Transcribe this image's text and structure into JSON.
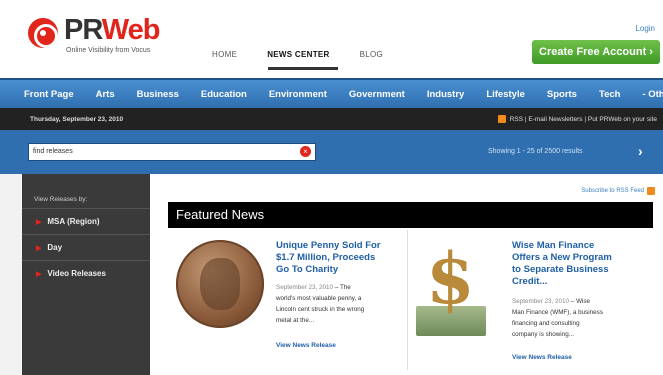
{
  "header": {
    "logo_word_pr": "PR",
    "logo_word_web": "Web",
    "logo_tagline": "Online Visibility from Vocus",
    "login": "Login",
    "cta": "Create Free Account ›"
  },
  "topnav": [
    "HOME",
    "NEWS CENTER",
    "BLOG"
  ],
  "categories": [
    "Front Page",
    "Arts",
    "Business",
    "Education",
    "Environment",
    "Government",
    "Industry",
    "Lifestyle",
    "Sports",
    "Tech",
    "- Oth"
  ],
  "datebar": {
    "date": "Thursday, September 23, 2010",
    "right_text": "RSS | E-mail Newsletters | Put PRWeb on your site"
  },
  "search": {
    "value": "find releases",
    "showing": "Showing 1 - 25 of 2500 results"
  },
  "sidebar": {
    "title": "View Releases by:",
    "items": [
      "MSA (Region)",
      "Day",
      "Video Releases"
    ]
  },
  "main": {
    "subscribe": "Subscribe to RSS Feed",
    "featured_title": "Featured News"
  },
  "cards": [
    {
      "title_lines": [
        "Unique Penny Sold For",
        "$1.7 Million, Proceeds",
        "Go To Charity"
      ],
      "date": "September 23, 2010",
      "summary_lines": [
        "– The",
        "world's most valuable penny, a",
        "Lincoln cent struck in the wrong",
        "metal at the..."
      ],
      "link": "View News Release"
    },
    {
      "title_lines": [
        "Wise Man Finance",
        "Offers a New Program",
        "to Separate Business",
        "Credit..."
      ],
      "date": "September 23, 2010",
      "summary_lines": [
        "– Wise",
        "Man Finance (WMF), a business",
        "financing and consulting",
        "company is showing..."
      ],
      "link": "View News Release"
    }
  ],
  "colors": {
    "brand_red": "#e1251b",
    "nav_blue": "#2f6fb0",
    "cta_green": "#4fae2f"
  }
}
